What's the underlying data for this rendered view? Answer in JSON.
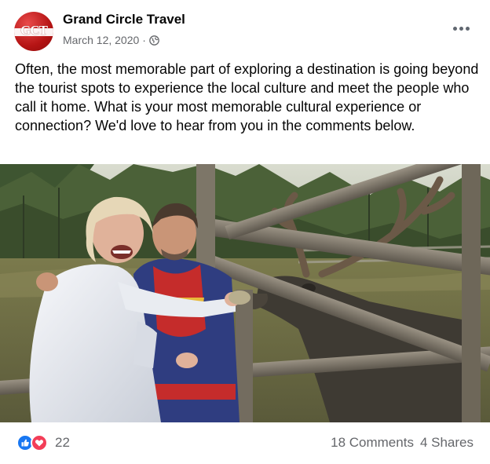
{
  "post": {
    "page_name": "Grand Circle Travel",
    "avatar_text": "GCT",
    "date": "March 12, 2020",
    "separator": "·",
    "privacy_icon": "globe-icon",
    "more_icon": "more-options-icon",
    "text": "Often, the most memorable part of exploring a destination is going beyond the tourist spots to experience the local culture and meet the people who call it home. What is your most memorable cultural experience or connection? We'd love to hear from you in the comments below.",
    "photo_description_icon": "photo"
  },
  "footer": {
    "reaction_icons": [
      "like-icon",
      "love-icon"
    ],
    "reaction_count": "22",
    "comments": "18 Comments",
    "shares": "4 Shares"
  },
  "colors": {
    "brand_red": "#c41a1a",
    "like_blue": "#1877f2",
    "love_red": "#f33e58",
    "meta_gray": "#65676b"
  }
}
